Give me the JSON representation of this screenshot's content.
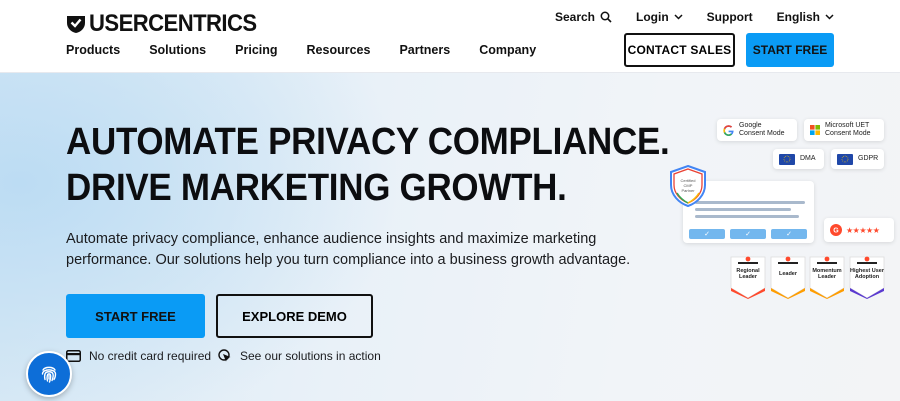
{
  "brand": {
    "name": "USERCENTRICS"
  },
  "top_links": {
    "search": "Search",
    "login": "Login",
    "support": "Support",
    "language": "English"
  },
  "nav": [
    "Products",
    "Solutions",
    "Pricing",
    "Resources",
    "Partners",
    "Company"
  ],
  "header_buttons": {
    "contact": "CONTACT SALES",
    "start": "START FREE"
  },
  "hero": {
    "headline_line1": "AUTOMATE PRIVACY COMPLIANCE.",
    "headline_line2": "DRIVE MARKETING GROWTH.",
    "subtext": "Automate privacy compliance, enhance audience insights and maximize marketing performance. Our solutions help you turn compliance into a business growth advantage.",
    "primary_button": "START FREE",
    "secondary_button": "EXPLORE DEMO",
    "feature_1": "No credit card required",
    "feature_2": "See our solutions in action"
  },
  "illustration": {
    "google_label": "Google\nConsent Mode",
    "microsoft_label": "Microsoft UET\nConsent Mode",
    "dma_label": "DMA",
    "gdpr_label": "GDPR",
    "shield_text": "Certified CMP Partner",
    "rating_stars": "★★★★★",
    "badges": [
      {
        "label": "Regional Leader",
        "top": "WINTER 2025 EUROPE"
      },
      {
        "label": "Leader",
        "top": "WINTER 2025"
      },
      {
        "label": "Momentum Leader",
        "top": "WINTER 2025"
      },
      {
        "label": "Highest User Adoption",
        "top": "WINTER 2025"
      }
    ]
  },
  "colors": {
    "accent_blue": "#0a9bf5",
    "fab_blue": "#0d6ed8",
    "g2_red": "#ff492c"
  }
}
